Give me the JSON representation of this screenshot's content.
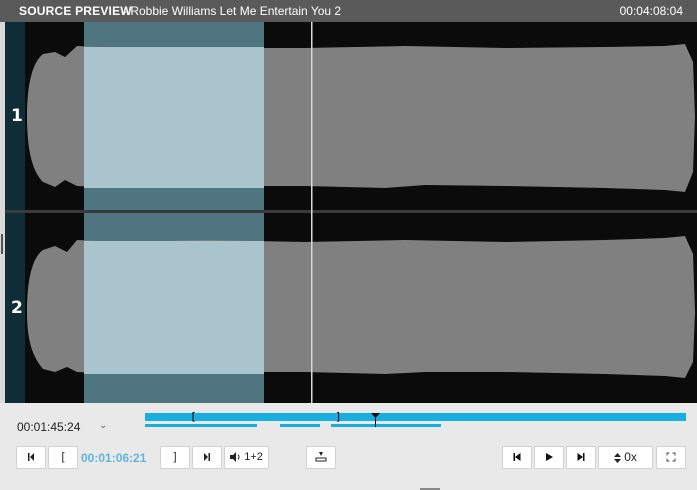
{
  "header": {
    "section_title": "SOURCE PREVIEW",
    "track_title": "- Robbie Williams Let Me Entertain You 2",
    "duration": "00:04:08:04"
  },
  "waveform": {
    "channels": [
      {
        "label": "1"
      },
      {
        "label": "2"
      }
    ],
    "selection_color": "#a9c4cc",
    "wave_color": "#808080",
    "background_color": "#0b0b0b",
    "playhead_time": "00:01:06:21"
  },
  "transport": {
    "current_time": "00:01:45:24",
    "in_point_time": "00:01:06:21",
    "set_in_bracket": "[",
    "set_out_bracket": "]",
    "audio_channels_label": "1+2",
    "speed_label": "0x",
    "accent_color": "#17aee0"
  },
  "icons": [
    "go-to-in-icon",
    "set-in-icon",
    "set-out-icon",
    "go-to-out-icon",
    "speaker-icon",
    "insert-icon",
    "previous-icon",
    "play-icon",
    "next-icon",
    "speed-arrows-icon",
    "fullscreen-icon",
    "dropdown-chevron-icon"
  ]
}
